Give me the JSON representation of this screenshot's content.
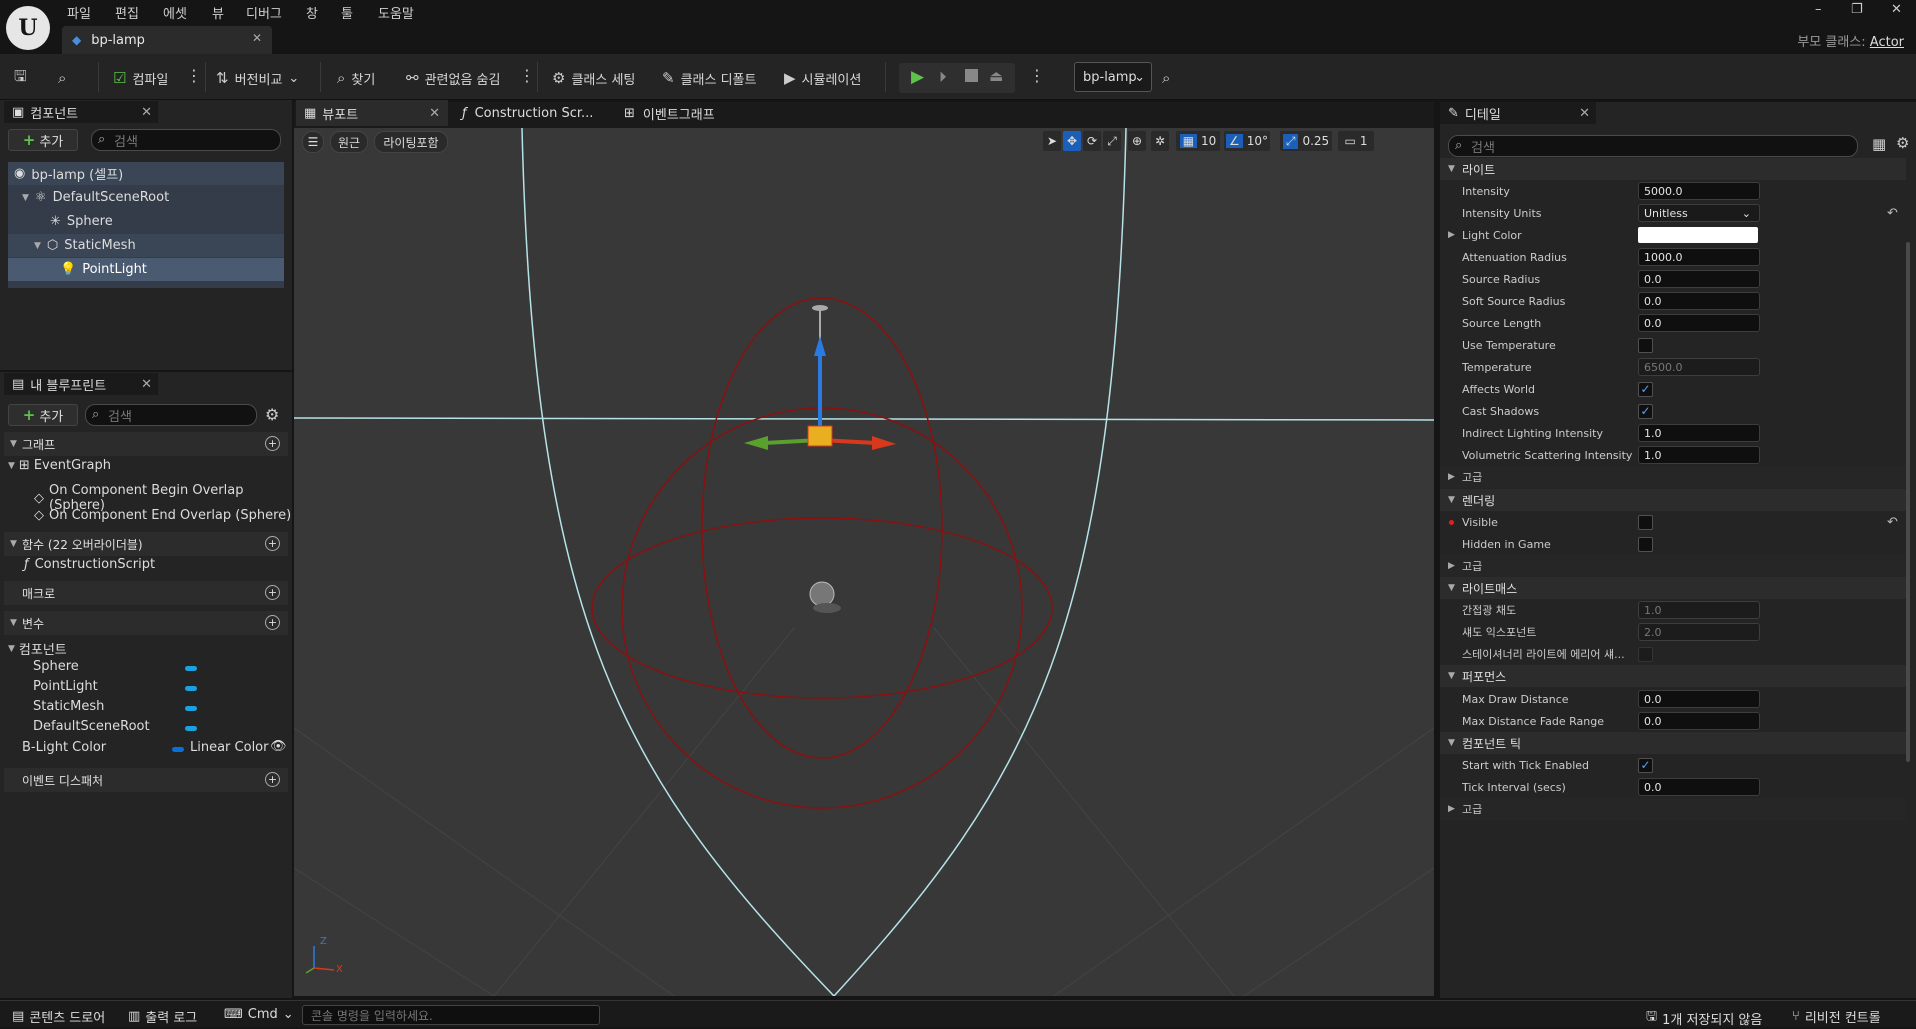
{
  "menu": [
    "파일",
    "편집",
    "에셋",
    "뷰",
    "디버그",
    "창",
    "툴",
    "도움말"
  ],
  "doc_tab": "bp-lamp",
  "parent_class": {
    "label": "부모 클래스:",
    "value": "Actor"
  },
  "toolbar": {
    "compile": "컴파일",
    "diff": "버전비교",
    "find": "찾기",
    "hide_unrelated": "관련없음 숨김",
    "class_settings": "클래스 세팅",
    "class_defaults": "클래스 디폴트",
    "simulation": "시뮬레이션",
    "debug_object": "bp-lamp"
  },
  "components_panel": {
    "tab": "컴포넌트",
    "add": "추가",
    "search_placeholder": "검색",
    "tree": [
      {
        "label": "bp-lamp (셀프)",
        "indent": 0,
        "icon": "actor-icon"
      },
      {
        "label": "DefaultSceneRoot",
        "indent": 1,
        "icon": "scene-root-icon"
      },
      {
        "label": "Sphere",
        "indent": 2,
        "icon": "sphere-component-icon"
      },
      {
        "label": "StaticMesh",
        "indent": 2,
        "icon": "static-mesh-icon"
      },
      {
        "label": "PointLight",
        "indent": 3,
        "icon": "point-light-icon"
      }
    ]
  },
  "blueprint_panel": {
    "tab": "내 블루프린트",
    "add": "추가",
    "search_placeholder": "검색",
    "graph_section": "그래프",
    "event_graph": "EventGraph",
    "events": [
      "On Component Begin Overlap (Sphere)",
      "On Component End Overlap (Sphere)"
    ],
    "functions_section": "함수 (22 오버라이더블)",
    "construction_script": "ConstructionScript",
    "macros_section": "매크로",
    "variables_section": "변수",
    "components_group": "컴포넌트",
    "component_vars": [
      "Sphere",
      "PointLight",
      "StaticMesh",
      "DefaultSceneRoot"
    ],
    "light_var": {
      "name": "B-Light Color",
      "type": "Linear Color"
    },
    "dispatchers_section": "이벤트 디스패처"
  },
  "editor_tabs": {
    "viewport": "뷰포트",
    "construction": "Construction Scr...",
    "event_graph": "이벤트그래프"
  },
  "viewport": {
    "perspective": "원근",
    "lit": "라이팅포함",
    "grid_snap": "10",
    "rotation_snap": "10°",
    "scale_snap": "0.25",
    "camera_speed": "1",
    "axis_x": "X",
    "axis_z": "Z"
  },
  "details": {
    "tab": "디테일",
    "search_placeholder": "검색",
    "light_section": "라이트",
    "intensity": {
      "label": "Intensity",
      "value": "5000.0"
    },
    "intensity_units": {
      "label": "Intensity Units",
      "value": "Unitless"
    },
    "light_color": {
      "label": "Light Color",
      "value": "#ffffff"
    },
    "attenuation_radius": {
      "label": "Attenuation Radius",
      "value": "1000.0"
    },
    "source_radius": {
      "label": "Source Radius",
      "value": "0.0"
    },
    "soft_source_radius": {
      "label": "Soft Source Radius",
      "value": "0.0"
    },
    "source_length": {
      "label": "Source Length",
      "value": "0.0"
    },
    "use_temperature": {
      "label": "Use Temperature",
      "checked": false
    },
    "temperature": {
      "label": "Temperature",
      "value": "6500.0"
    },
    "affects_world": {
      "label": "Affects World",
      "checked": true
    },
    "cast_shadows": {
      "label": "Cast Shadows",
      "checked": true
    },
    "indirect_lighting": {
      "label": "Indirect Lighting Intensity",
      "value": "1.0"
    },
    "volumetric": {
      "label": "Volumetric Scattering Intensity",
      "value": "1.0"
    },
    "advanced": "고급",
    "rendering_section": "렌더링",
    "visible": {
      "label": "Visible",
      "checked": false
    },
    "hidden_in_game": {
      "label": "Hidden in Game",
      "checked": false
    },
    "lightmass_section": "라이트매스",
    "indirect_saturation": {
      "label": "간접광 채도",
      "value": "1.0"
    },
    "shadow_exponent": {
      "label": "섀도 익스포넌트",
      "value": "2.0"
    },
    "stationary_area": {
      "label": "스테이셔너리 라이트에 에리어 섀...",
      "checked": false
    },
    "performance_section": "퍼포먼스",
    "max_draw_distance": {
      "label": "Max Draw Distance",
      "value": "0.0"
    },
    "max_fade_range": {
      "label": "Max Distance Fade Range",
      "value": "0.0"
    },
    "tick_section": "컴포넌트 틱",
    "start_tick": {
      "label": "Start with Tick Enabled",
      "checked": true
    },
    "tick_interval": {
      "label": "Tick Interval (secs)",
      "value": "0.0"
    }
  },
  "statusbar": {
    "content_drawer": "콘텐츠 드로어",
    "output_log": "출력 로그",
    "cmd": "Cmd",
    "cmd_placeholder": "콘솔 명령을 입력하세요.",
    "unsaved": "1개 저장되지 않음",
    "revision": "리비전 컨트롤"
  },
  "colors": {
    "accent": "#1ba1e2",
    "selection": "#4a5a70",
    "light_sphere": "#8b1010",
    "play_green": "#5fc24a"
  }
}
